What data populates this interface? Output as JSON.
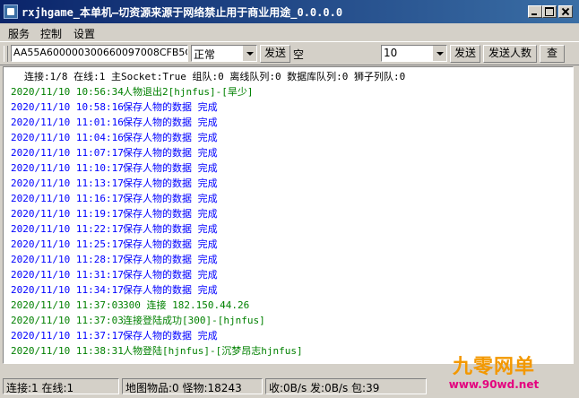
{
  "window": {
    "title": "rxjhgame_本单机—切资源来源于网络禁止用于商业用途_0.0.0.0"
  },
  "menu": [
    "服务",
    "控制",
    "设置"
  ],
  "toolbar": {
    "command_value": "AA55A600000300660097008CFB5CDB3(",
    "mode_value": "正常",
    "send_label": "发送",
    "empty_label": "空",
    "count_value": "10",
    "send2_label": "发送",
    "send_people_label": "发送人数",
    "check_label": "查"
  },
  "log": {
    "status_line": "连接:1/8 在线:1 主Socket:True 组队:0 离线队列:0 数据库队列:0 狮子列队:0",
    "lines": [
      {
        "time": "2020/11/10  10:56:34",
        "msg": "人物退出2[hjnfus]-[旱少]",
        "color": "#008000"
      },
      {
        "time": "2020/11/10  10:58:16",
        "msg": "保存人物的数据 完成",
        "color": "#0000ff"
      },
      {
        "time": "2020/11/10  11:01:16",
        "msg": "保存人物的数据 完成",
        "color": "#0000ff"
      },
      {
        "time": "2020/11/10  11:04:16",
        "msg": "保存人物的数据 完成",
        "color": "#0000ff"
      },
      {
        "time": "2020/11/10  11:07:17",
        "msg": "保存人物的数据 完成",
        "color": "#0000ff"
      },
      {
        "time": "2020/11/10  11:10:17",
        "msg": "保存人物的数据 完成",
        "color": "#0000ff"
      },
      {
        "time": "2020/11/10  11:13:17",
        "msg": "保存人物的数据 完成",
        "color": "#0000ff"
      },
      {
        "time": "2020/11/10  11:16:17",
        "msg": "保存人物的数据 完成",
        "color": "#0000ff"
      },
      {
        "time": "2020/11/10  11:19:17",
        "msg": "保存人物的数据 完成",
        "color": "#0000ff"
      },
      {
        "time": "2020/11/10  11:22:17",
        "msg": "保存人物的数据 完成",
        "color": "#0000ff"
      },
      {
        "time": "2020/11/10  11:25:17",
        "msg": "保存人物的数据 完成",
        "color": "#0000ff"
      },
      {
        "time": "2020/11/10  11:28:17",
        "msg": "保存人物的数据 完成",
        "color": "#0000ff"
      },
      {
        "time": "2020/11/10  11:31:17",
        "msg": "保存人物的数据 完成",
        "color": "#0000ff"
      },
      {
        "time": "2020/11/10  11:34:17",
        "msg": "保存人物的数据 完成",
        "color": "#0000ff"
      },
      {
        "time": "2020/11/10  11:37:03",
        "msg": "300 连接 182.150.44.26",
        "color": "#008000"
      },
      {
        "time": "2020/11/10  11:37:03",
        "msg": "连接登陆成功[300]-[hjnfus]",
        "color": "#008000"
      },
      {
        "time": "2020/11/10  11:37:17",
        "msg": "保存人物的数据 完成",
        "color": "#0000ff"
      },
      {
        "time": "2020/11/10  11:38:31",
        "msg": "人物登陆[hjnfus]-[沉梦昂志hjnfus]",
        "color": "#008000"
      }
    ]
  },
  "statusbar": {
    "conn": "连接:1 在线:1",
    "map": "地图物品:0 怪物:18243",
    "traffic": "收:0B/s 发:0B/s 包:39"
  },
  "watermark": {
    "line1": "九零网单",
    "line2": "www.90wd.net"
  }
}
